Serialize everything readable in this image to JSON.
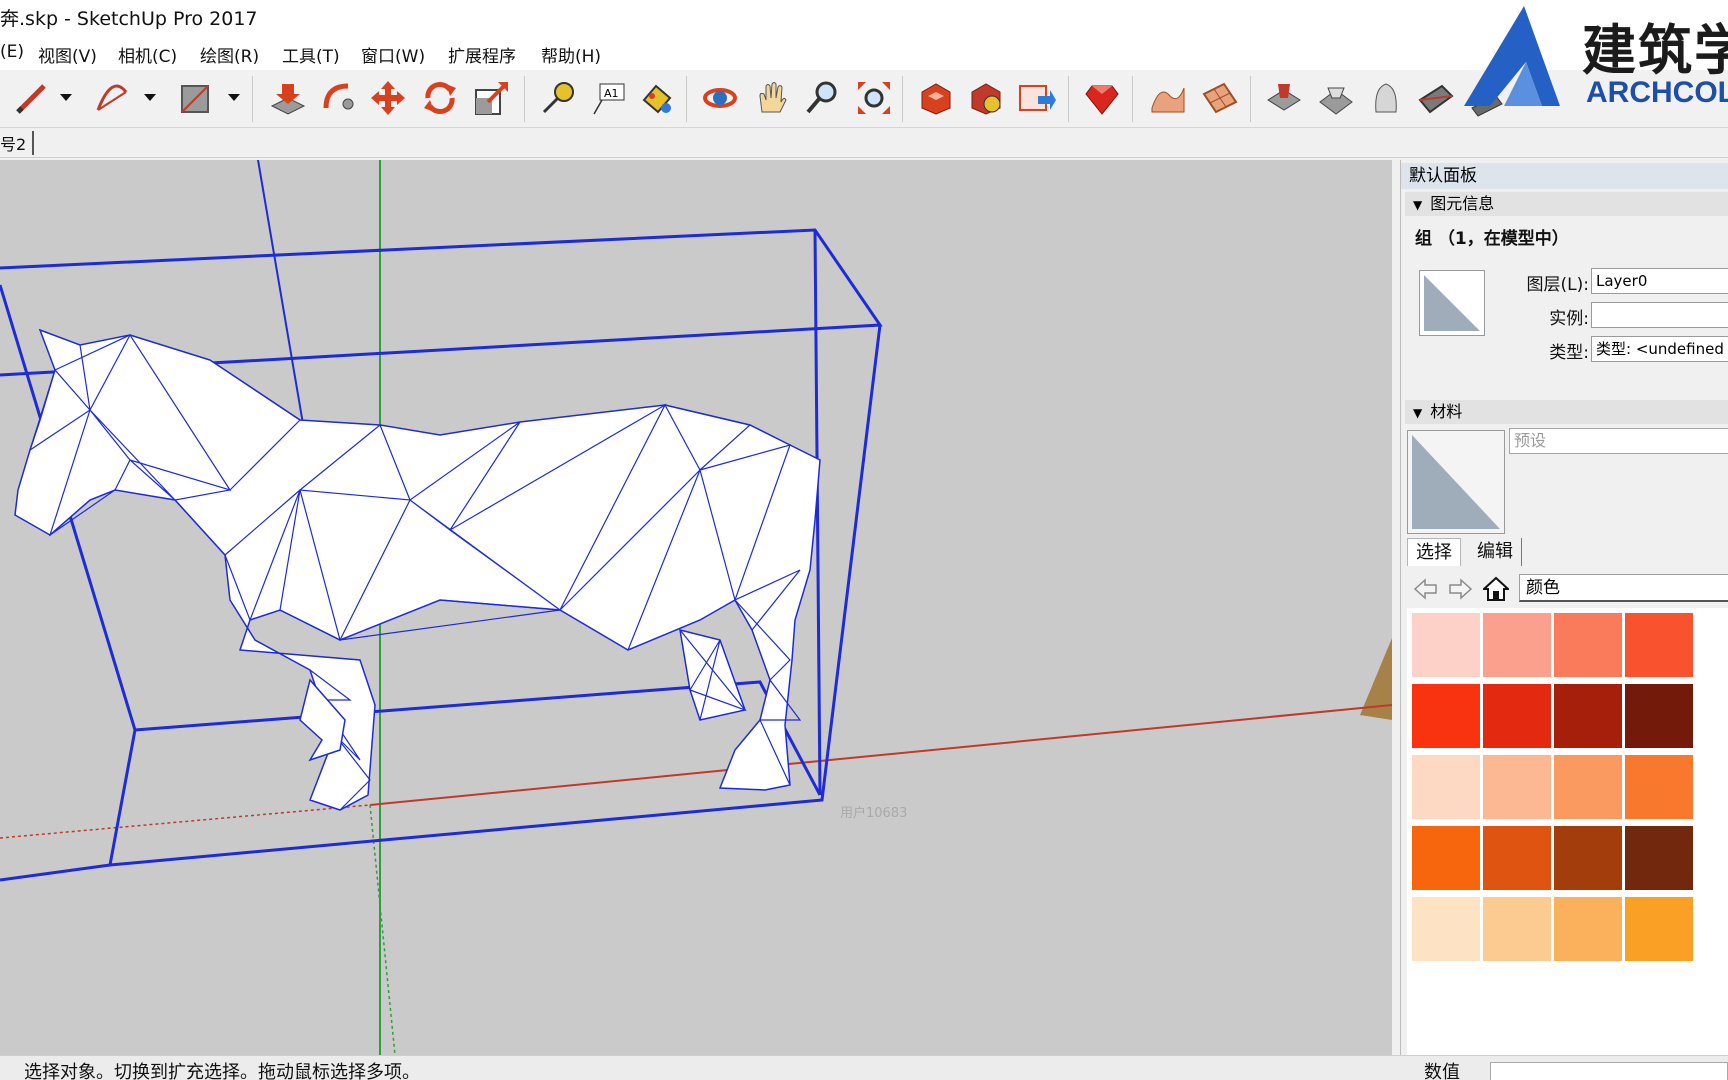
{
  "window": {
    "title": "奔.skp - SketchUp Pro 2017"
  },
  "menu": [
    {
      "label": "(E)"
    },
    {
      "label": "视图(V)"
    },
    {
      "label": "相机(C)"
    },
    {
      "label": "绘图(R)"
    },
    {
      "label": "工具(T)"
    },
    {
      "label": "窗口(W)"
    },
    {
      "label": "扩展程序"
    },
    {
      "label": "帮助(H)"
    }
  ],
  "toolbar": {
    "icons": [
      "pencil-icon",
      "arc-icon",
      "rectangle-icon",
      "push-pull-icon",
      "follow-me-icon",
      "move-icon",
      "rotate-icon",
      "scale-icon",
      "tape-measure-icon",
      "text-icon",
      "paint-bucket-icon",
      "orbit-icon",
      "pan-icon",
      "zoom-icon",
      "zoom-extents-icon",
      "warehouse-icon",
      "extension-warehouse-icon",
      "send-to-layout-icon",
      "ruby-icon",
      "sandbox-smoove-icon",
      "sandbox-grid-icon",
      "stamp-icon",
      "drape-icon",
      "add-detail-icon",
      "flip-edge-icon",
      "from-contours-icon"
    ]
  },
  "scene_tab": {
    "label": "号2"
  },
  "viewport": {
    "watermark": "用户10683",
    "bbox_color": "#1e2bd6",
    "axis_red": "#c0392b",
    "axis_green": "#2e9e3e"
  },
  "panel": {
    "title": "默认面板",
    "entity_info": {
      "header": "图元信息",
      "entity_title": "组 （1，在模型中）",
      "layer_label": "图层(L):",
      "layer_value": "Layer0",
      "instance_label": "实例:",
      "instance_value": "",
      "type_label": "类型:",
      "type_value": "类型:  <undefined"
    },
    "materials": {
      "header": "材料",
      "name_placeholder": "预设",
      "tab_select": "选择",
      "tab_edit": "编辑",
      "collection": "颜色",
      "swatches": [
        "#fdd1c7",
        "#fba08c",
        "#fa7a5c",
        "#f8532e",
        "#f93210",
        "#e32a10",
        "#a61f0a",
        "#741a0a",
        "#fdd8c2",
        "#fbb893",
        "#fa9a61",
        "#f8792e",
        "#f7660c",
        "#de5410",
        "#a33d0c",
        "#72280c",
        "#fde3c4",
        "#fccb91",
        "#fbb15b",
        "#faa125"
      ]
    }
  },
  "status": {
    "hint": "选择对象。切换到扩充选择。拖动鼠标选择多项。",
    "measure_label": "数值"
  },
  "logo": {
    "cn": "建筑学",
    "en": "ARCHCOL"
  }
}
